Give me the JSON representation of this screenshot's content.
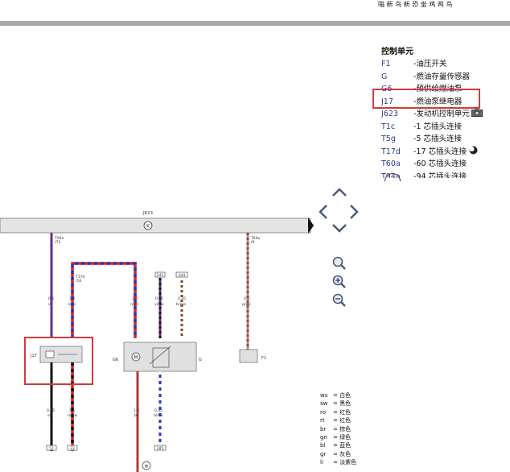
{
  "header": {
    "top_text": "嗡 新 鸟 新 恐 坐 鸡 鸡 鸟"
  },
  "legend": {
    "title": "控制单元",
    "items": [
      {
        "code": "F1",
        "desc": "-油压开关"
      },
      {
        "code": "G",
        "desc": "-燃油存量传感器"
      },
      {
        "code": "G6",
        "desc": "-预供给燃油泵"
      },
      {
        "code": "J17",
        "desc": "-燃油泵继电器"
      },
      {
        "code": "J623",
        "desc": "-发动机控制单元"
      },
      {
        "code": "T1c",
        "desc": "-1 芯插头连接"
      },
      {
        "code": "T5g",
        "desc": "-5 芯插头连接"
      },
      {
        "code": "T17d",
        "desc": "-17 芯插头连接"
      },
      {
        "code": "T60a",
        "desc": "-60 芯插头连接"
      },
      {
        "code": "T94a",
        "desc": "-94 芯插头连接"
      }
    ],
    "highlighted_code": "J17"
  },
  "diagram": {
    "bus_label": "J623",
    "ground_symbol": "K",
    "wires": [
      {
        "pin": "T94a\n/73",
        "size": "0.5",
        "color": "vi"
      },
      {
        "pin": "T17d\n/16",
        "size": "1.0",
        "color": "ro/bl"
      },
      {
        "pin": "",
        "size": "1.0",
        "color": "ro/bl"
      },
      {
        "pin": "",
        "size": "0.35",
        "color": "vi/sw"
      },
      {
        "pin": "",
        "size": "0.35",
        "color": "br/ws"
      },
      {
        "pin": "T60a\n/9",
        "size": "0.5",
        "color": "gr/br"
      }
    ],
    "top_refs": [
      "241",
      "344"
    ],
    "j17_label": "J17",
    "g6_label": "G6",
    "g_label": "G",
    "f1_label": "F1",
    "bottom_wires": [
      {
        "size": "0.75",
        "color": "sw"
      },
      {
        "size": "1.5",
        "color": "ro/sw"
      },
      {
        "size": "1.5",
        "color": "br"
      },
      {
        "size": "0.35",
        "color": "bl/ws"
      }
    ],
    "bottom_refs": [
      "51",
      "33",
      "285"
    ],
    "ground_bottom": "⊕"
  },
  "colorkey": [
    {
      "abbr": "ws",
      "name": "白色"
    },
    {
      "abbr": "sw",
      "name": "黑色"
    },
    {
      "abbr": "ro",
      "name": "红色"
    },
    {
      "abbr": "rt",
      "name": "红色"
    },
    {
      "abbr": "br",
      "name": "棕色"
    },
    {
      "abbr": "gn",
      "name": "绿色"
    },
    {
      "abbr": "bl",
      "name": "蓝色"
    },
    {
      "abbr": "gr",
      "name": "灰色"
    },
    {
      "abbr": "li",
      "name": "淡紫色"
    }
  ],
  "colors": {
    "highlight": "#d23a3a",
    "wire_red": "#e02020",
    "wire_blue": "#2236c8",
    "wire_violet": "#6b2a8c",
    "wire_black": "#111111",
    "wire_brownred": "#b03a3a"
  },
  "tools": {
    "icons": [
      "arrow-up-icon",
      "arrow-left-icon",
      "arrow-right-icon",
      "arrow-down-icon",
      "zoom-fit-icon",
      "zoom-in-icon",
      "zoom-out-icon"
    ]
  }
}
